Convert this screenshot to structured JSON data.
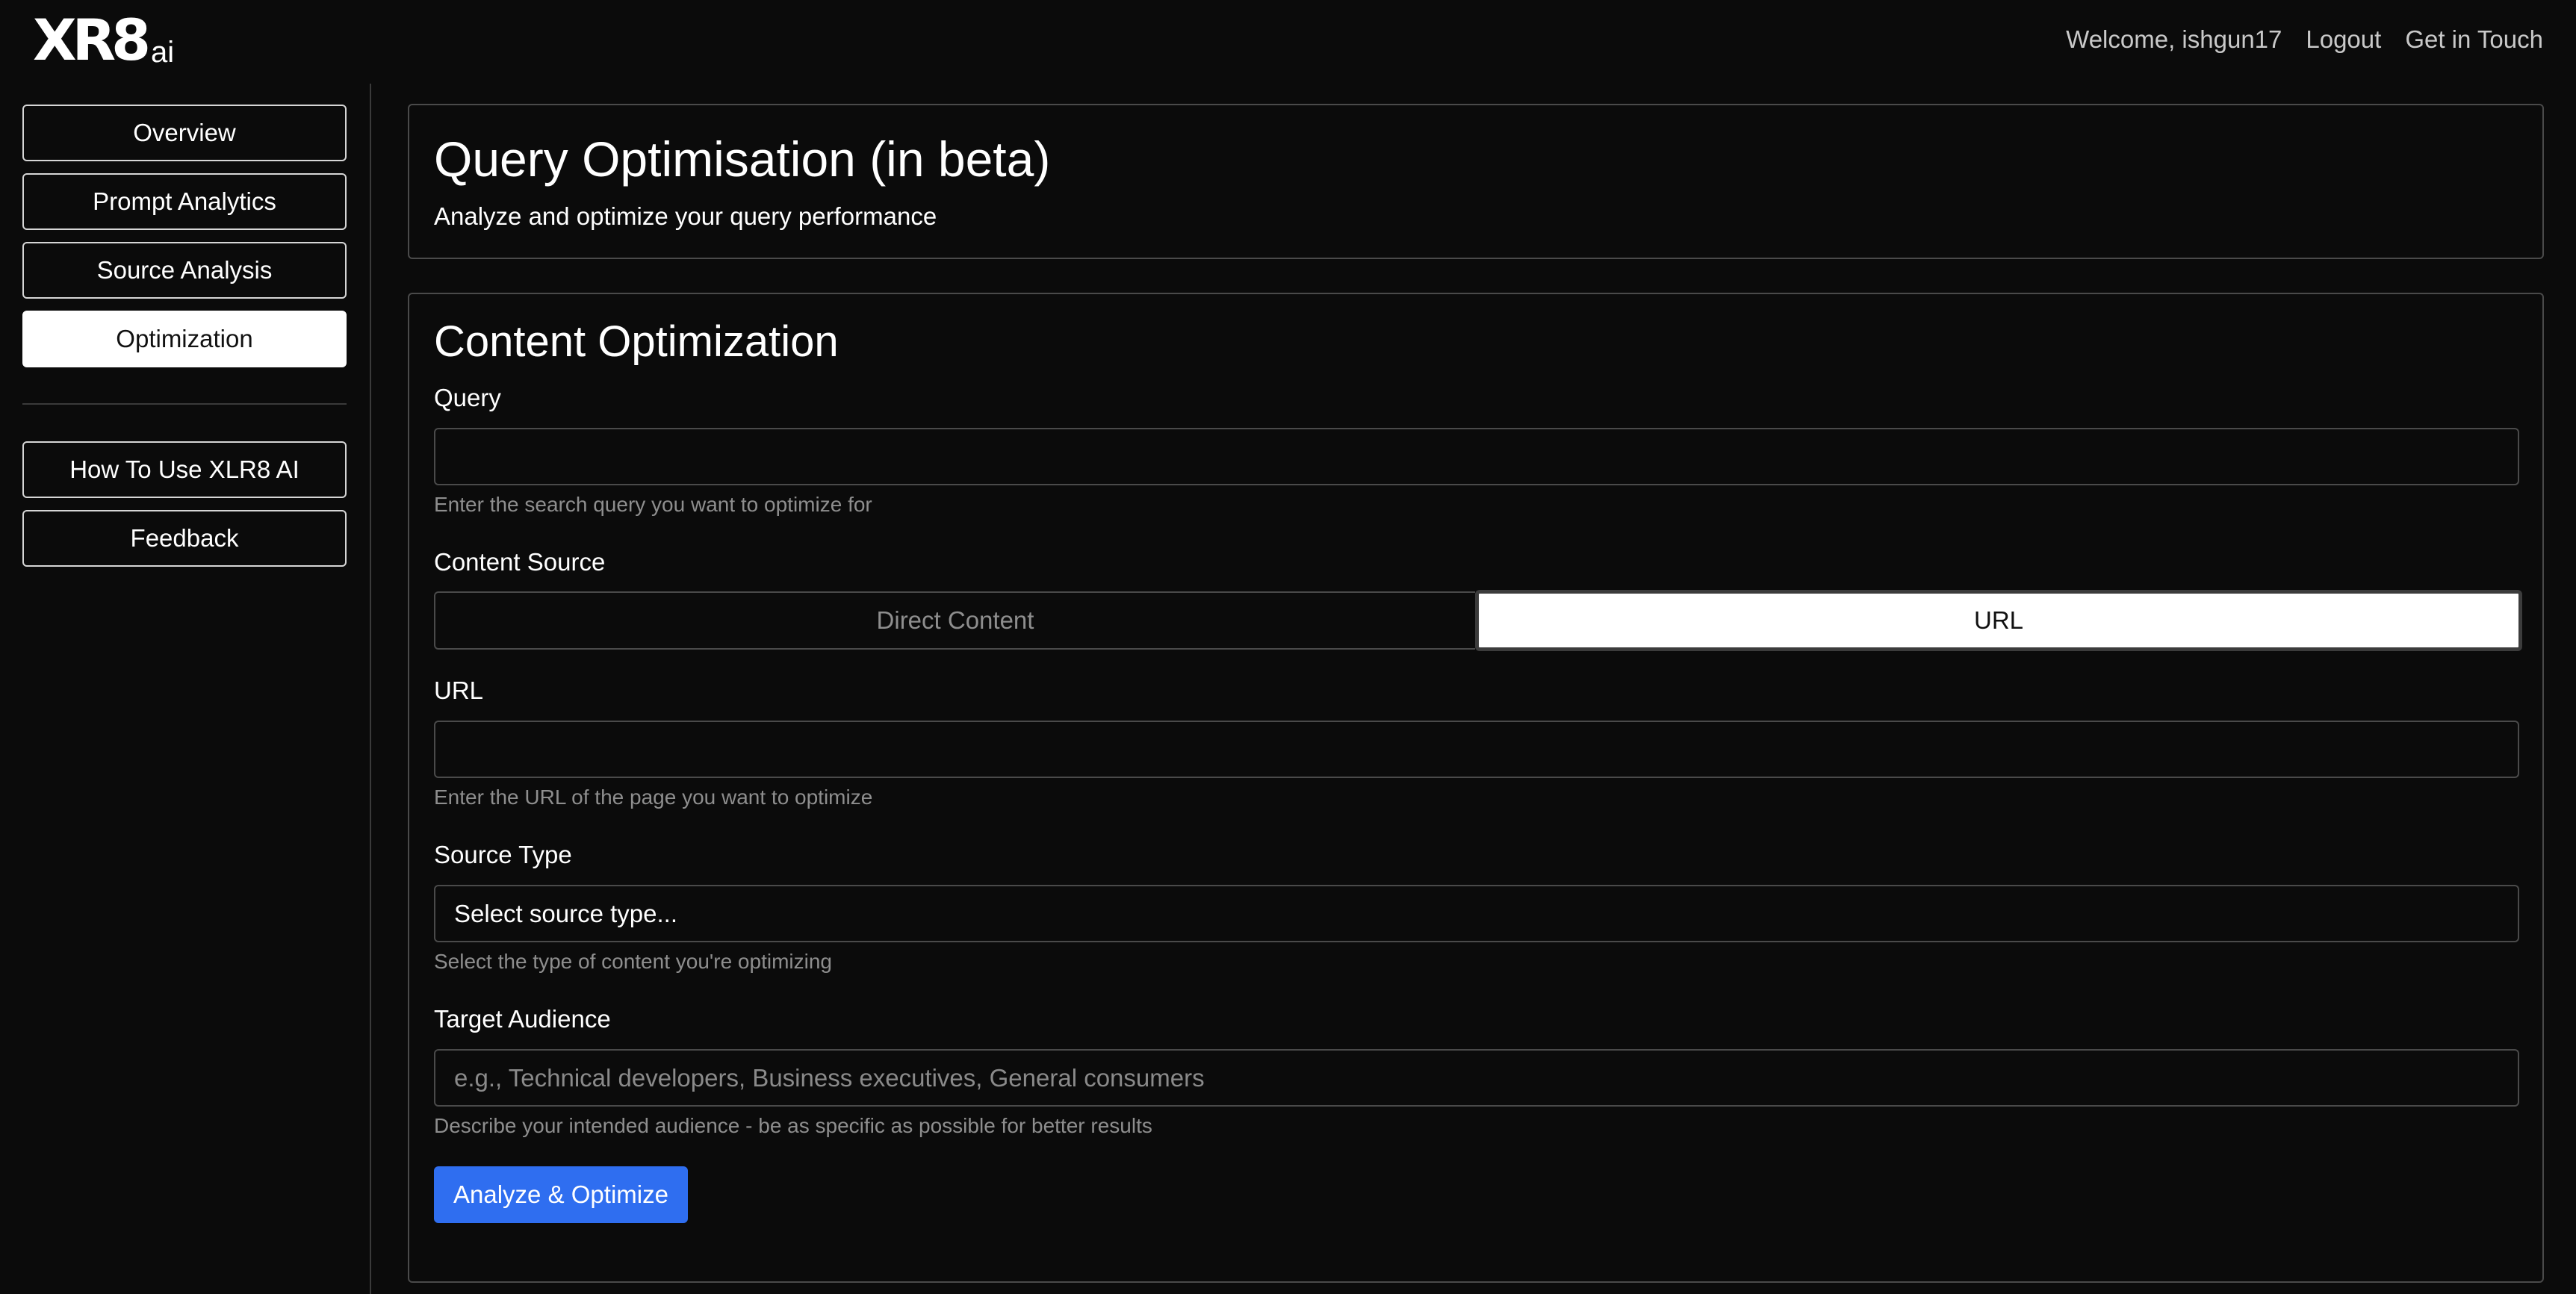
{
  "header": {
    "logo_main": "XR8",
    "logo_suffix": "ai",
    "welcome": "Welcome, ishgun17",
    "logout": "Logout",
    "contact": "Get in Touch"
  },
  "sidebar": {
    "items": [
      {
        "label": "Overview",
        "active": false
      },
      {
        "label": "Prompt Analytics",
        "active": false
      },
      {
        "label": "Source Analysis",
        "active": false
      },
      {
        "label": "Optimization",
        "active": true
      }
    ],
    "secondary_items": [
      {
        "label": "How To Use XLR8 AI"
      },
      {
        "label": "Feedback"
      }
    ]
  },
  "page_header": {
    "title": "Query Optimisation (in beta)",
    "subtitle": "Analyze and optimize your query performance"
  },
  "form": {
    "title": "Content Optimization",
    "query": {
      "label": "Query",
      "value": "",
      "placeholder": "",
      "help": "Enter the search query you want to optimize for"
    },
    "content_source": {
      "label": "Content Source",
      "options": [
        "Direct Content",
        "URL"
      ],
      "selected": "URL"
    },
    "url": {
      "label": "URL",
      "value": "",
      "placeholder": "",
      "help": "Enter the URL of the page you want to optimize"
    },
    "source_type": {
      "label": "Source Type",
      "selected": "Select source type...",
      "help": "Select the type of content you're optimizing"
    },
    "target_audience": {
      "label": "Target Audience",
      "value": "",
      "placeholder": "e.g., Technical developers, Business executives, General consumers",
      "help": "Describe your intended audience - be as specific as possible for better results"
    },
    "submit_label": "Analyze & Optimize"
  },
  "colors": {
    "background": "#0b0b0b",
    "primary": "#2f6ef0",
    "border": "#4a4a4a",
    "muted_text": "#8e8e8e"
  }
}
